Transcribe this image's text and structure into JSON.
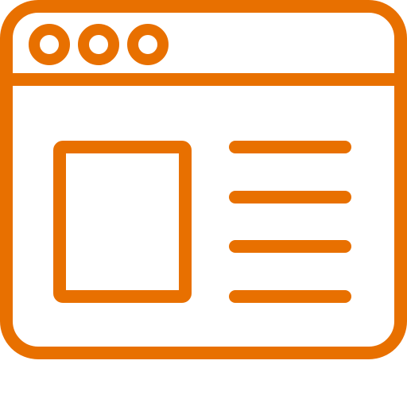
{
  "icon": {
    "name": "browser-window-icon",
    "color": "#E87000",
    "background": "#FFFFFF",
    "parts": {
      "window_controls": [
        "window-control-dot",
        "window-control-dot",
        "window-control-dot"
      ],
      "content_image": "image-placeholder",
      "content_text_lines": 4
    }
  }
}
